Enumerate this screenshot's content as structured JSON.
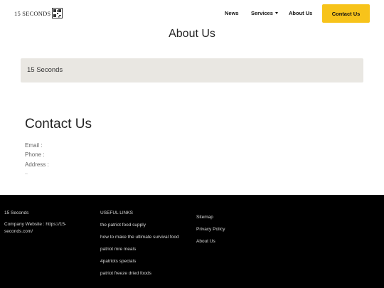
{
  "nav": {
    "brand": "15 SECONDS",
    "brand_icon": "qr-code-icon",
    "links": [
      {
        "label": "News"
      },
      {
        "label": "Services"
      },
      {
        "label": "About Us"
      }
    ],
    "cta_label": "Contact Us",
    "cta_color": "#f7c31a"
  },
  "main": {
    "title": "About Us",
    "company_name": "15 Seconds",
    "contact_title": "Contact Us",
    "email_label": "Email :",
    "phone_label": "Phone :",
    "address_label": "Address :",
    "dots": ".."
  },
  "footer": {
    "company": "15 Seconds",
    "website_text": "Company Website : https://15-seconds.com/",
    "useful_links_heading": "USEFUL LINKS",
    "useful_links": [
      "the patriot food supply",
      "how to make the ultimate survival food",
      "patriot mre meals",
      "4patriots specials",
      "patriot freeze dried foods"
    ],
    "links": [
      "Sitemap",
      "Privacy Policy",
      "About Us"
    ]
  }
}
